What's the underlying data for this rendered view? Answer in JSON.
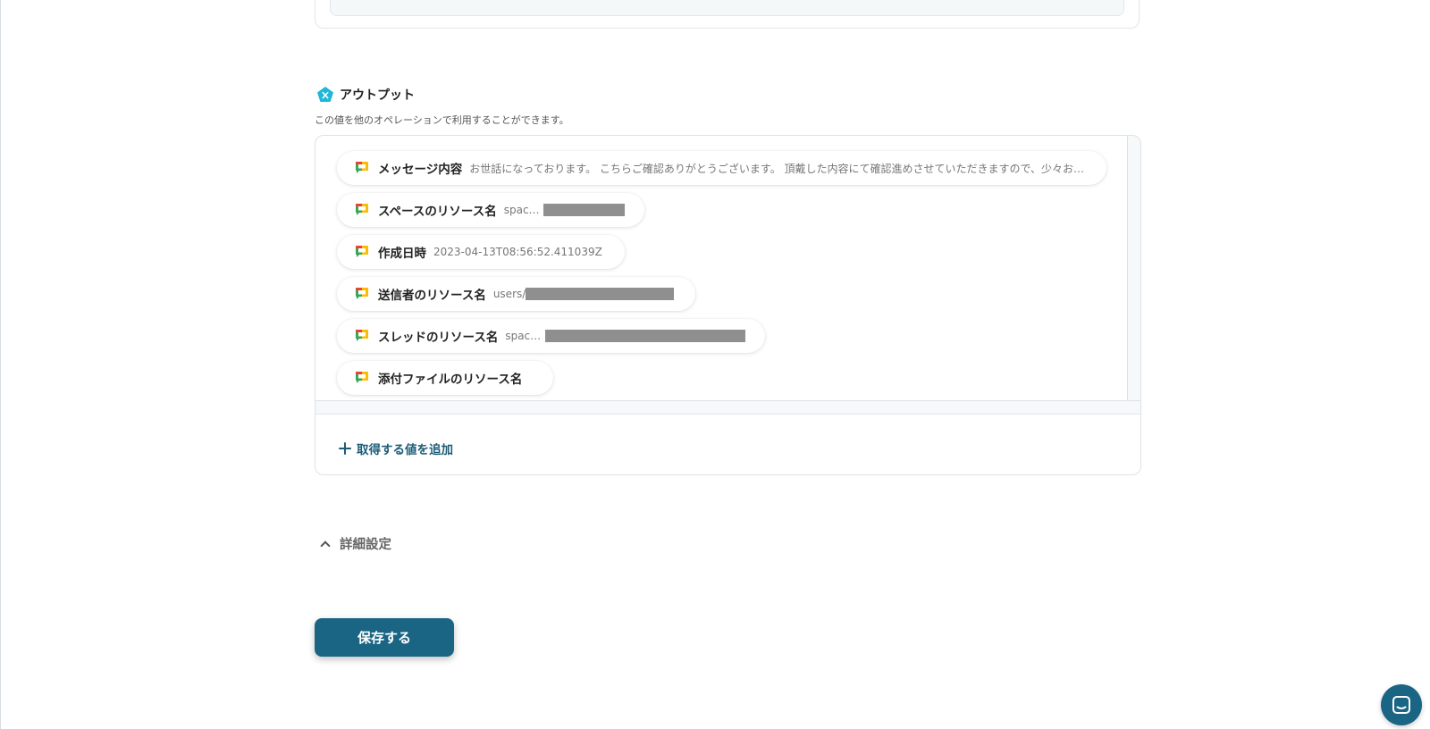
{
  "output": {
    "title": "アウトプット",
    "description": "この値を他のオペレーションで利用することができます。",
    "items": [
      {
        "label": "メッセージ内容",
        "value": "お世話になっております。 こちらご確認ありがとうございます。 頂戴した内容にて確認進めさせていただきますので、少々お待…",
        "redacted": false
      },
      {
        "label": "スペースのリソース名",
        "value": "spaces/",
        "redacted": true
      },
      {
        "label": "作成日時",
        "value": "2023-04-13T08:56:52.411039Z",
        "redacted": false
      },
      {
        "label": "送信者のリソース名",
        "value": "users/",
        "redacted": true
      },
      {
        "label": "スレッドのリソース名",
        "value": "spaces/",
        "redacted": true
      },
      {
        "label": "添付ファイルのリソース名",
        "value": "",
        "redacted": false
      }
    ],
    "add_label": "取得する値を追加"
  },
  "details": {
    "label": "詳細設定"
  },
  "save_button": {
    "label": "保存する"
  },
  "colors": {
    "accent": "#1a6583",
    "link": "#1b5c78",
    "output_icon": "#1fb7d8",
    "redaction": "#8f8f8f"
  },
  "icons": {
    "output": "output-pentagon-icon",
    "chip": "google-chat-icon",
    "add": "plus-icon",
    "details": "chevron-up-icon",
    "launcher": "chat-bubble-icon"
  }
}
